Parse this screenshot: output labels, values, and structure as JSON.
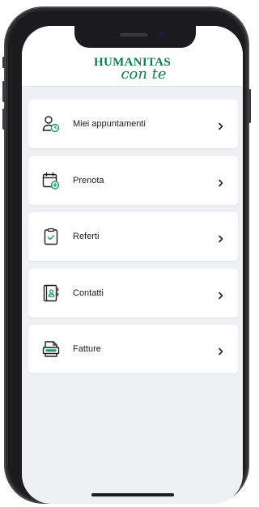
{
  "app": {
    "logo_top": "HUMANITAS",
    "logo_bottom": "con te"
  },
  "colors": {
    "brand": "#0c7b4f",
    "accent_icon": "#1f9b6a",
    "background": "#eef0f4"
  },
  "menu": {
    "items": [
      {
        "label": "Miei appuntamenti",
        "icon": "user-clock-icon"
      },
      {
        "label": "Prenota",
        "icon": "calendar-add-icon"
      },
      {
        "label": "Referti",
        "icon": "clipboard-check-icon"
      },
      {
        "label": "Contatti",
        "icon": "contact-book-icon"
      },
      {
        "label": "Fatture",
        "icon": "invoice-doc-icon"
      }
    ]
  }
}
